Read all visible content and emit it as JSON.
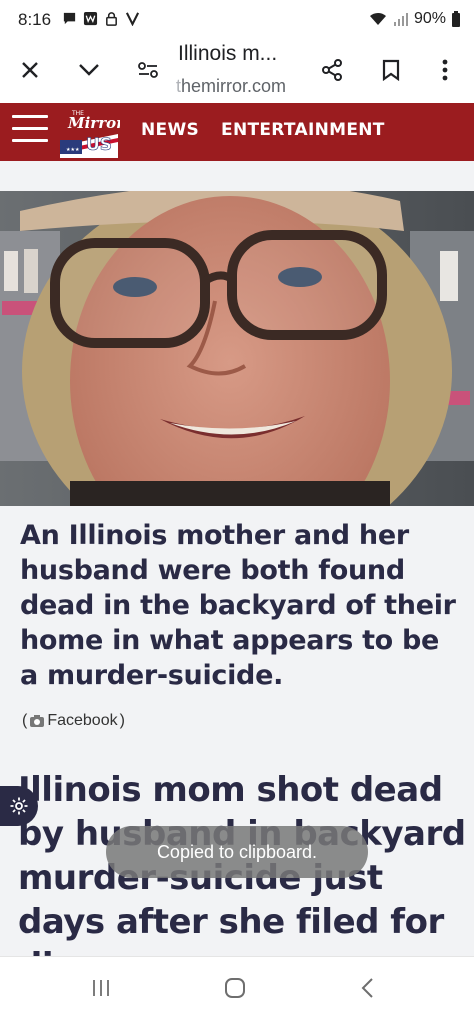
{
  "status_bar": {
    "time": "8:16",
    "battery": "90%",
    "left_icons": [
      "chat-icon",
      "w-app-icon",
      "lock-icon",
      "v-icon"
    ],
    "right_icons": [
      "wifi-icon",
      "signal-icon",
      "battery-icon"
    ]
  },
  "browser": {
    "tab_title": "Illinois m...",
    "url_prefix": "t",
    "url_rest": "hemirror.com",
    "buttons": [
      "close-icon",
      "chevron-down-icon",
      "site-settings-icon",
      "share-icon",
      "bookmark-icon",
      "more-icon"
    ]
  },
  "site": {
    "logo_top": "THE",
    "logo_name": "Mirror",
    "logo_us": "US",
    "nav": [
      "NEWS",
      "ENTERTAINMENT"
    ],
    "brand_color": "#9b1c1f"
  },
  "article": {
    "caption": "An Illinois mother and her husband were both found dead in the backyard of their home in what appears to be a murder-suicide.",
    "credit_open": "(",
    "credit_source": "Facebook",
    "credit_close": ")",
    "headline": "Illinois mom shot dead by husband in backyard murder-suicide just days after she filed for divorce"
  },
  "toast": {
    "text": "Copied to clipboard."
  },
  "bottom_nav": [
    "recents-icon",
    "home-icon",
    "back-icon"
  ]
}
